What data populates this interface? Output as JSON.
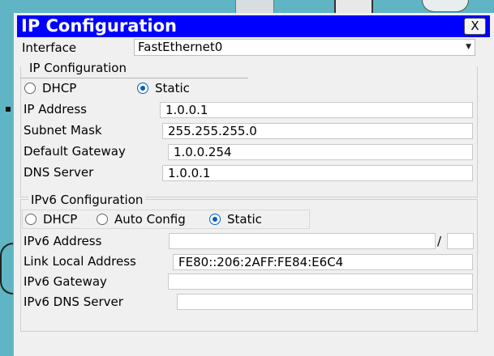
{
  "dialog": {
    "title": "IP Configuration",
    "close_label": "X"
  },
  "interface": {
    "label": "Interface",
    "selected": "FastEthernet0"
  },
  "ipv4": {
    "legend": "IP Configuration",
    "dhcp_label": "DHCP",
    "static_label": "Static",
    "mode": "Static",
    "ip_address_label": "IP Address",
    "ip_address": "1.0.0.1",
    "subnet_mask_label": "Subnet Mask",
    "subnet_mask": "255.255.255.0",
    "default_gateway_label": "Default Gateway",
    "default_gateway": "1.0.0.254",
    "dns_server_label": "DNS Server",
    "dns_server": "1.0.0.1"
  },
  "ipv6": {
    "legend": "IPv6 Configuration",
    "dhcp_label": "DHCP",
    "auto_label": "Auto Config",
    "static_label": "Static",
    "mode": "Static",
    "address_label": "IPv6 Address",
    "address": "",
    "prefix_separator": "/",
    "prefix": "",
    "link_local_label": "Link Local Address",
    "link_local": "FE80::206:2AFF:FE84:E6C4",
    "gateway_label": "IPv6 Gateway",
    "gateway": "",
    "dns_label": "IPv6 DNS Server",
    "dns": ""
  },
  "colors": {
    "title_bar": "#0000ff",
    "radio_selected": "#0060c0",
    "desktop": "#5fb5c4"
  }
}
